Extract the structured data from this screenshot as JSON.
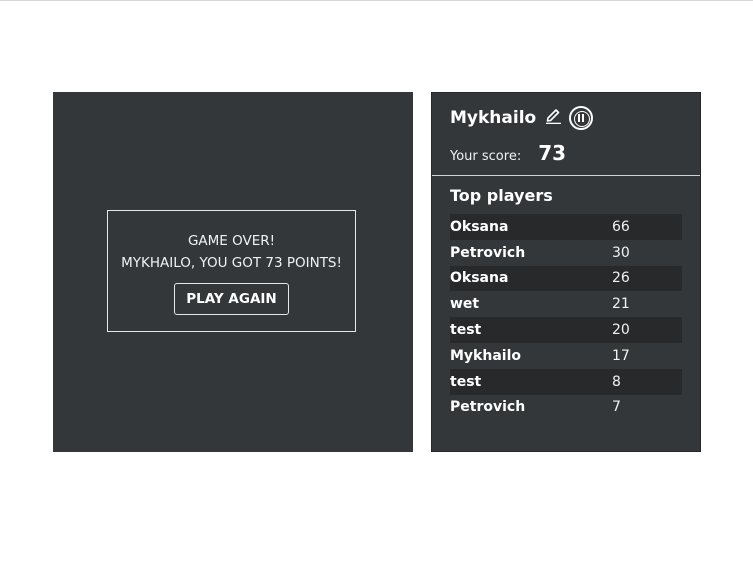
{
  "game": {
    "over_text": "GAME OVER!",
    "result_text": "MYKHAILO, YOU GOT 73 POINTS!",
    "play_again_label": "PLAY AGAIN"
  },
  "player": {
    "name": "Mykhailo",
    "score_label": "Your score:",
    "score": "73"
  },
  "leaderboard": {
    "title": "Top players",
    "rows": [
      {
        "name": "Oksana",
        "score": "66"
      },
      {
        "name": "Petrovich",
        "score": "30"
      },
      {
        "name": "Oksana",
        "score": "26"
      },
      {
        "name": "wet",
        "score": "21"
      },
      {
        "name": "test",
        "score": "20"
      },
      {
        "name": "Mykhailo",
        "score": "17"
      },
      {
        "name": "test",
        "score": "8"
      },
      {
        "name": "Petrovich",
        "score": "7"
      }
    ]
  },
  "icons": {
    "edit": "edit-icon",
    "pause": "pause-icon"
  },
  "colors": {
    "panel_bg": "#33373a",
    "row_stripe": "#27292b",
    "text": "#ffffff"
  }
}
